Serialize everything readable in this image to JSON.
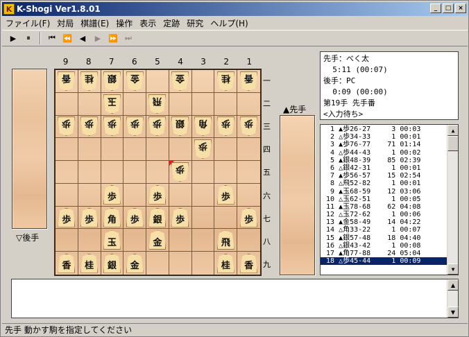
{
  "window": {
    "title": "K-Shogi Ver1.8.01",
    "app_icon_letter": "K",
    "buttons": {
      "minimize": "_",
      "maximize": "□",
      "close": "×"
    }
  },
  "menu": [
    "ファイル(F)",
    "対局",
    "棋譜(E)",
    "操作",
    "表示",
    "定跡",
    "研究",
    "ヘルプ(H)"
  ],
  "toolbar": [
    "▶",
    "⏸",
    "⏮",
    "⏪",
    "◀",
    "▶",
    "⏩",
    "⏭"
  ],
  "board": {
    "columns": [
      "9",
      "8",
      "7",
      "6",
      "5",
      "4",
      "3",
      "2",
      "1"
    ],
    "rows": [
      "一",
      "二",
      "三",
      "四",
      "五",
      "六",
      "七",
      "八",
      "九"
    ],
    "pieces": [
      {
        "sq": "91",
        "k": "香",
        "g": true
      },
      {
        "sq": "81",
        "k": "桂",
        "g": true
      },
      {
        "sq": "71",
        "k": "銀",
        "g": true
      },
      {
        "sq": "61",
        "k": "金",
        "g": true
      },
      {
        "sq": "41",
        "k": "金",
        "g": true
      },
      {
        "sq": "21",
        "k": "桂",
        "g": true
      },
      {
        "sq": "11",
        "k": "香",
        "g": true
      },
      {
        "sq": "72",
        "k": "玉",
        "g": true
      },
      {
        "sq": "52",
        "k": "飛",
        "g": true
      },
      {
        "sq": "93",
        "k": "歩",
        "g": true
      },
      {
        "sq": "83",
        "k": "歩",
        "g": true
      },
      {
        "sq": "73",
        "k": "歩",
        "g": true
      },
      {
        "sq": "63",
        "k": "歩",
        "g": true
      },
      {
        "sq": "53",
        "k": "歩",
        "g": true
      },
      {
        "sq": "43",
        "k": "銀",
        "g": true
      },
      {
        "sq": "33",
        "k": "角",
        "g": true
      },
      {
        "sq": "23",
        "k": "歩",
        "g": true
      },
      {
        "sq": "13",
        "k": "歩",
        "g": true
      },
      {
        "sq": "34",
        "k": "歩",
        "g": true
      },
      {
        "sq": "45",
        "k": "歩",
        "g": true,
        "last": true
      },
      {
        "sq": "76",
        "k": "歩",
        "g": false
      },
      {
        "sq": "56",
        "k": "歩",
        "g": false
      },
      {
        "sq": "26",
        "k": "歩",
        "g": false
      },
      {
        "sq": "97",
        "k": "歩",
        "g": false
      },
      {
        "sq": "87",
        "k": "歩",
        "g": false
      },
      {
        "sq": "77",
        "k": "角",
        "g": false
      },
      {
        "sq": "67",
        "k": "歩",
        "g": false
      },
      {
        "sq": "57",
        "k": "銀",
        "g": false
      },
      {
        "sq": "47",
        "k": "歩",
        "g": false
      },
      {
        "sq": "17",
        "k": "歩",
        "g": false
      },
      {
        "sq": "78",
        "k": "玉",
        "g": false
      },
      {
        "sq": "58",
        "k": "金",
        "g": false
      },
      {
        "sq": "28",
        "k": "飛",
        "g": false
      },
      {
        "sq": "99",
        "k": "香",
        "g": false
      },
      {
        "sq": "89",
        "k": "桂",
        "g": false
      },
      {
        "sq": "79",
        "k": "銀",
        "g": false
      },
      {
        "sq": "69",
        "k": "金",
        "g": false
      },
      {
        "sq": "29",
        "k": "桂",
        "g": false
      },
      {
        "sq": "19",
        "k": "香",
        "g": false
      }
    ]
  },
  "hands": {
    "gote_label": "▽後手",
    "sente_label": "▲先手"
  },
  "info": {
    "sente_label": "先手：べく太",
    "sente_time": "  5:11 (00:07)",
    "gote_label": "後手：PC",
    "gote_time": "  0:09 (00:00)",
    "turn": "第19手 先手番",
    "state": "<入力待ち>"
  },
  "kifu": [
    "  1 ▲歩26-27     3 00:03",
    "  2 △歩34-33     1 00:01",
    "  3 ▲歩76-77    71 01:14",
    "  4 △歩44-43     1 00:02",
    "  5 ▲銀48-39    85 02:39",
    "  6 △銀42-31     1 00:01",
    "  7 ▲歩56-57    15 02:54",
    "  8 △飛52-82     1 00:01",
    "  9 ▲玉68-59    12 03:06",
    " 10 △玉62-51     1 00:05",
    " 11 ▲玉78-68    62 04:08",
    " 12 △玉72-62     1 00:06",
    " 13 ▲金58-49    14 04:22",
    " 14 △角33-22     1 00:07",
    " 15 ▲銀57-48    18 04:40",
    " 16 △銀43-42     1 00:08",
    " 17 ▲角77-88    24 05:04",
    " 18 △歩45-44     1 00:09"
  ],
  "kifu_selected": 17,
  "status": "先手 動かす駒を指定してください"
}
